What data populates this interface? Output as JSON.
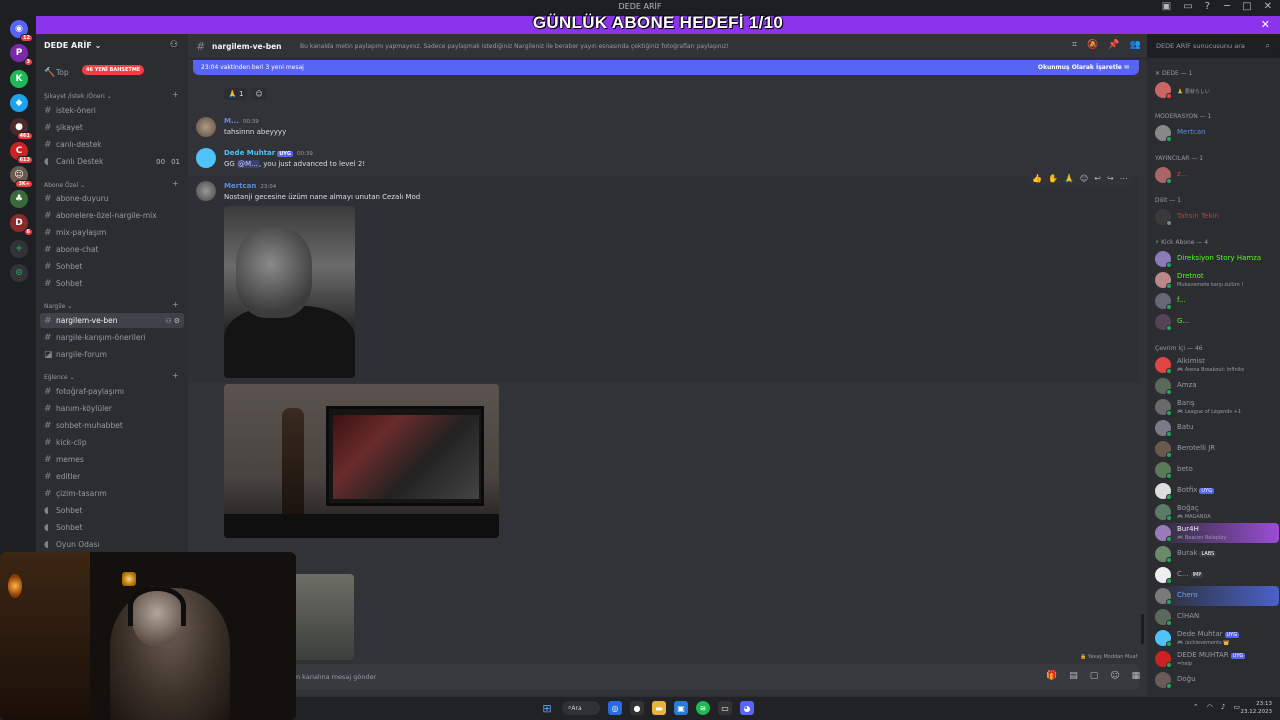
{
  "window": {
    "title": "DEDE ARİF"
  },
  "banner": {
    "text": "GÜNLÜK ABONE HEDEFİ 1/10"
  },
  "rail": {
    "badges": [
      "12",
      "3",
      "461",
      "613",
      "3K+",
      "6"
    ]
  },
  "sidebar": {
    "server_name": "DEDE ARİF",
    "new_badge": "46 YENİ BAHSETME",
    "top_item": "Top",
    "categories": [
      "Şikayet /İstek /Öneri",
      "Abone Özel",
      "Nargile",
      "Eğlence"
    ],
    "channels": {
      "istek_oneri": "istek-öneri",
      "sikayet": "şikayet",
      "canli_destek": "canlı-destek",
      "canli_destek_voice": "Canlı Destek",
      "canli_destek_count": "00",
      "canli_destek_count2": "01",
      "abone_duyuru": "abone-duyuru",
      "abonelere_ozel": "abonelere-özel-nargile-mix",
      "mix_paylasim": "mix-paylaşım",
      "abone_chat": "abone-chat",
      "sohbet1": "Sohbet",
      "sohbet2": "Sohbet",
      "nargilem_ve_ben": "nargilem-ve-ben",
      "nargile_karisim": "nargile-karışım-önerileri",
      "nargile_forum": "nargile-forum",
      "fotograf": "fotoğraf-paylaşımı",
      "hanim_koyluler": "hanım-köylüler",
      "sohbet_muhabbet": "sohbet-muhabbet",
      "kick_clip": "kick-clip",
      "memes": "memes",
      "editler": "editler",
      "cizim_tasarim": "çizim-tasarım",
      "sohbet_v1": "Sohbet",
      "sohbet_v2": "Sohbet",
      "oyun_odasi": "Oyun Odası"
    }
  },
  "header": {
    "channel": "nargilem-ve-ben",
    "topic": "Bu kanalda metin paylaşımı yapmayınız. Sadece paylaşmak istediğiniz Nargileniz ile beraber yayın esnasında çektiğiniz fotoğrafları paylaşınız!",
    "search_placeholder": "DEDE ARİF sunucusunu ara"
  },
  "new_messages_bar": {
    "text": "23:04 vaktinden beri 3 yeni mesaj",
    "mark_read": "Okunmuş Olarak İşaretle"
  },
  "messages": [
    {
      "reaction_count": "1"
    },
    {
      "author": "M...",
      "time": "00:39",
      "text": "tahsinnn abeyyyy"
    },
    {
      "author": "Dede Muhtar",
      "badge": "UYG",
      "time": "00:39",
      "prefix": "GG",
      "mention": "@M...",
      "text": ", you just advanced to level 2!"
    },
    {
      "author": "Mertcan",
      "time": "23:04",
      "text": "Nostanji gecesine üzüm nane almayı unutan Cezalı Mod"
    }
  ],
  "composer": {
    "placeholder": "en kanalına mesaj gönder",
    "slowmode": "Yavaş Moddan Muaf"
  },
  "members": {
    "cat_dede": "DEDE — 1",
    "dede_status": "🙏 要就らしい",
    "cat_mod": "MODERASYON — 1",
    "mod1": "Mertcan",
    "cat_yayinci": "YAYINCILAR — 1",
    "yay1": "z...",
    "cat_dolt": "Dölt — 1",
    "dolt1": "Tahsin Tekin",
    "cat_kick": "Kick Abone — 4",
    "kick1": "Direksiyon Story Hamza",
    "kick2": "Dretnot",
    "kick2_sub": "Mukavemete karşı zulüm !",
    "kick3": "f...",
    "kick4": "G...",
    "cat_online": "Çevrim İçi — 46",
    "on": [
      {
        "name": "Alkimist",
        "sub": "🎮 Arena Breakout: Infinite"
      },
      {
        "name": "Amza",
        "sub": ""
      },
      {
        "name": "Barış",
        "sub": "🎮 League of Legends +1"
      },
      {
        "name": "Batu",
        "sub": ""
      },
      {
        "name": "Berotelli JR",
        "sub": ""
      },
      {
        "name": "beto",
        "sub": ""
      },
      {
        "name": "Botfix",
        "sub": "",
        "badge": "UYG"
      },
      {
        "name": "Boğaç",
        "sub": "🎮 MAGANDA"
      },
      {
        "name": "Bur4H",
        "sub": "🎮 Beacon Roleplay"
      },
      {
        "name": "Burak",
        "sub": "",
        "badge": "LABS"
      },
      {
        "name": "C...",
        "sub": "",
        "badge": "IMP"
      },
      {
        "name": "Chero",
        "sub": ""
      },
      {
        "name": "CİHAN",
        "sub": ""
      },
      {
        "name": "Dede Muhtar",
        "sub": "🎮 /achievements 👑",
        "badge": "UYG"
      },
      {
        "name": "DEDE MUHTAR",
        "sub": "=help",
        "badge": "UYG"
      },
      {
        "name": "Doğu",
        "sub": ""
      }
    ]
  },
  "taskbar": {
    "search": "Ara",
    "time": "23:13",
    "date": "23.12.2023"
  },
  "colors": {
    "banner": "#8c33ec",
    "blurple": "#5865f2",
    "online": "#23a55a",
    "idle": "#f0b232",
    "dnd": "#f23f43"
  }
}
